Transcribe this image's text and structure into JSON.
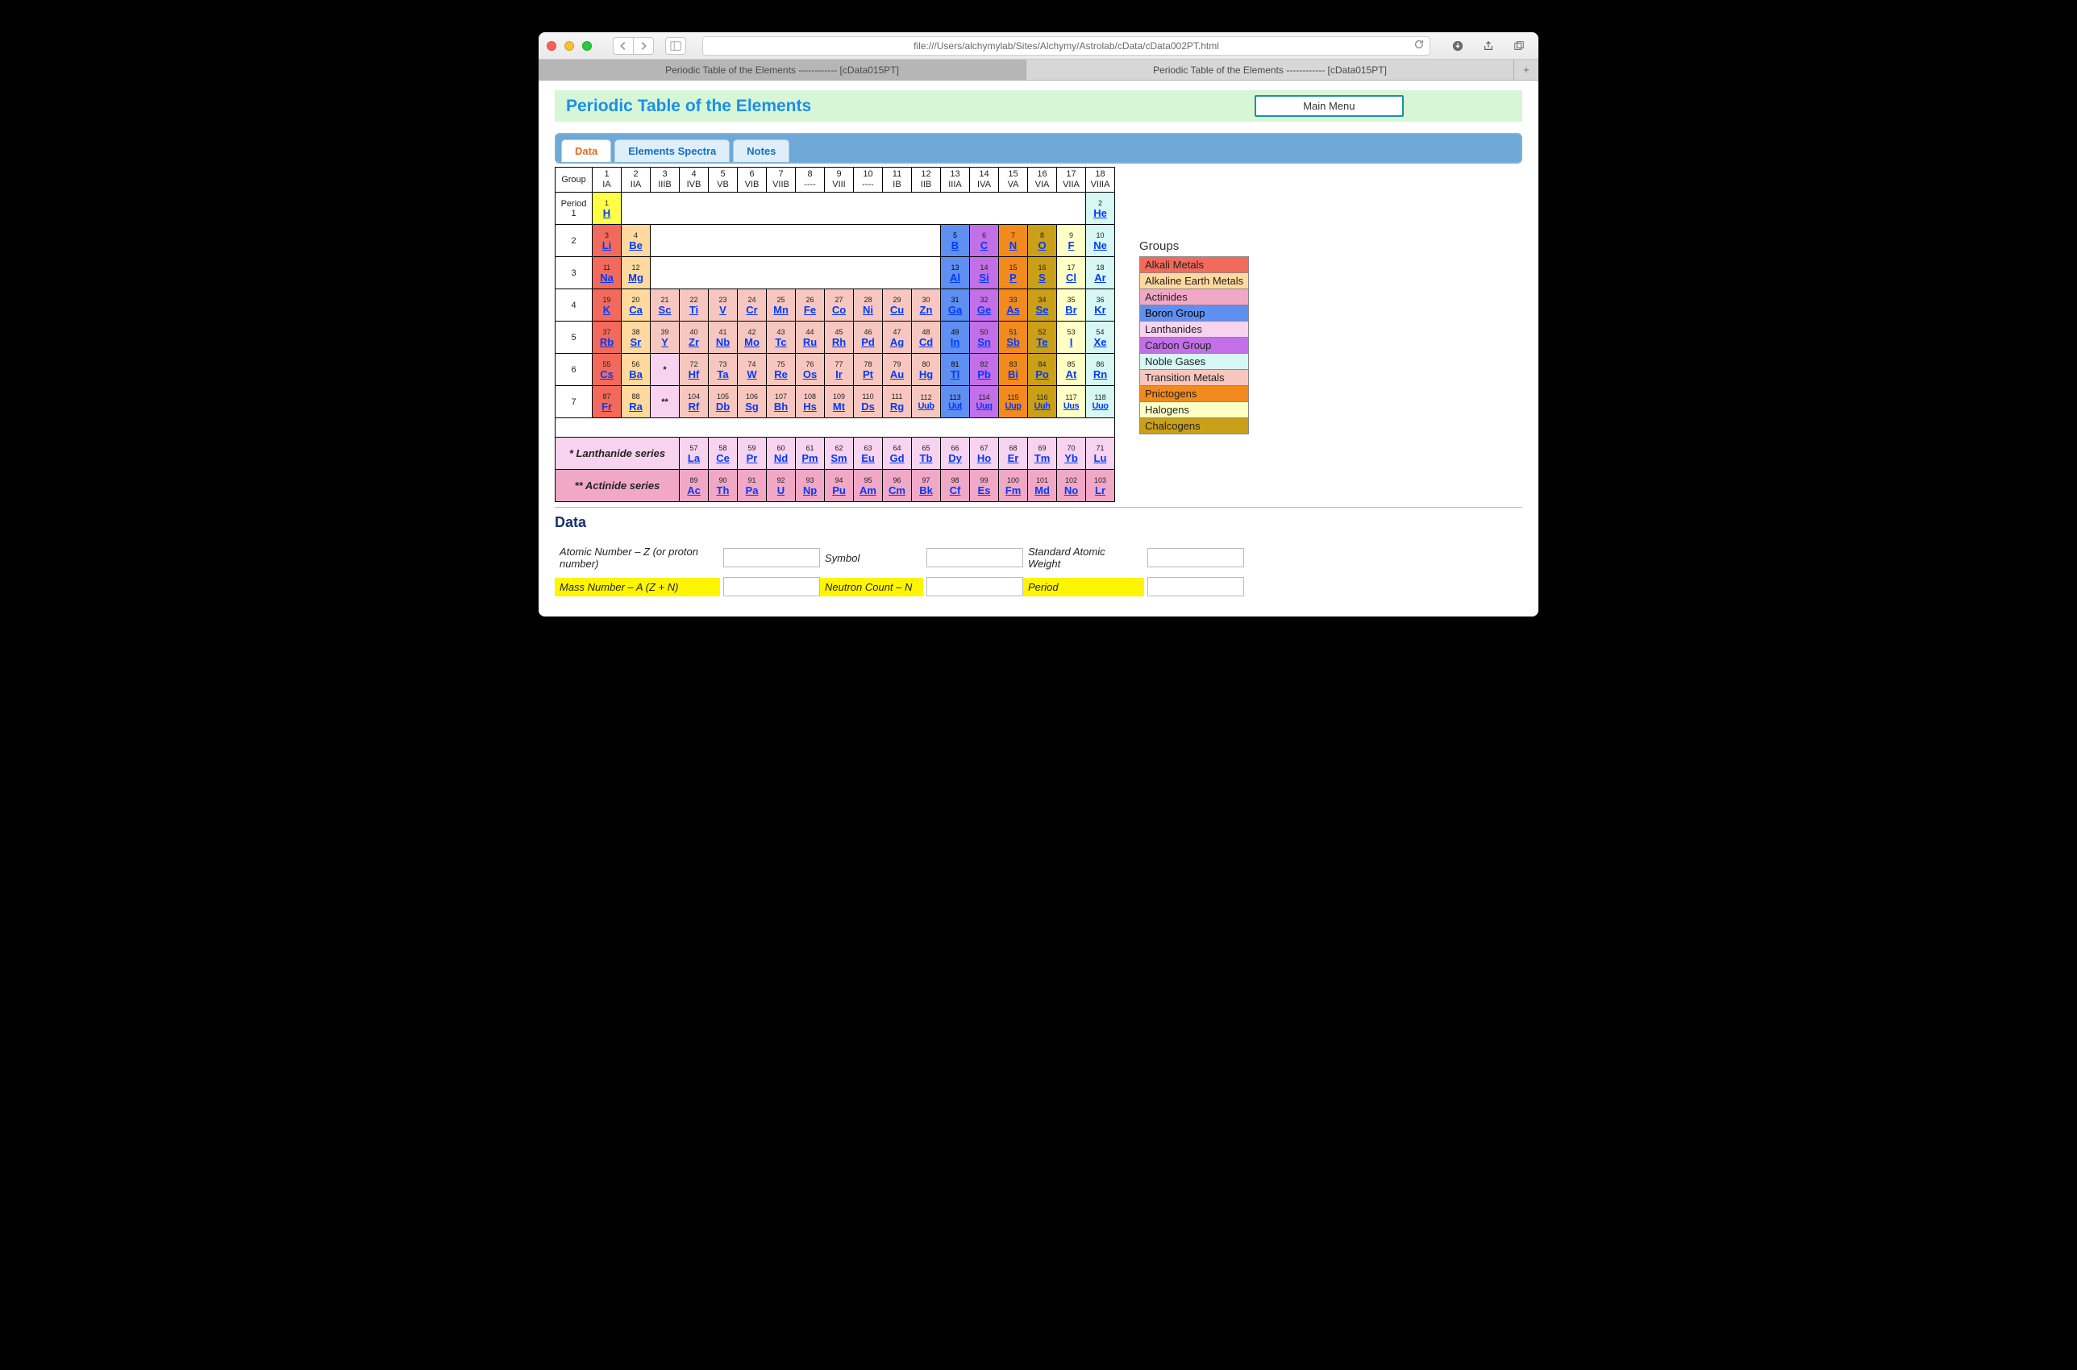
{
  "browser": {
    "url": "file:///Users/alchymylab/Sites/Alchymy/Astrolab/cData/cData002PT.html",
    "tabs": [
      "Periodic Table of the Elements ------------ [cData015PT]",
      "Periodic Table of the Elements ------------ [cData015PT]"
    ],
    "active_tab": 0
  },
  "header": {
    "title": "Periodic Table of the Elements",
    "main_menu": "Main Menu"
  },
  "page_tabs": {
    "items": [
      "Data",
      "Elements Spectra",
      "Notes"
    ],
    "active": 0
  },
  "group_header": {
    "label": "Group",
    "cols": [
      {
        "n": "1",
        "r": "IA"
      },
      {
        "n": "2",
        "r": "IIA"
      },
      {
        "n": "3",
        "r": "IIIB"
      },
      {
        "n": "4",
        "r": "IVB"
      },
      {
        "n": "5",
        "r": "VB"
      },
      {
        "n": "6",
        "r": "VIB"
      },
      {
        "n": "7",
        "r": "VIIB"
      },
      {
        "n": "8",
        "r": "----"
      },
      {
        "n": "9",
        "r": "VIII"
      },
      {
        "n": "10",
        "r": "----"
      },
      {
        "n": "11",
        "r": "IB"
      },
      {
        "n": "12",
        "r": "IIB"
      },
      {
        "n": "13",
        "r": "IIIA"
      },
      {
        "n": "14",
        "r": "IVA"
      },
      {
        "n": "15",
        "r": "VA"
      },
      {
        "n": "16",
        "r": "VIA"
      },
      {
        "n": "17",
        "r": "VIIA"
      },
      {
        "n": "18",
        "r": "VIIIA"
      }
    ]
  },
  "period_labels": [
    "Period 1",
    "2",
    "3",
    "4",
    "5",
    "6",
    "7"
  ],
  "rows": [
    [
      {
        "z": 1,
        "s": "H",
        "c": "c-H"
      },
      null,
      null,
      null,
      null,
      null,
      null,
      null,
      null,
      null,
      null,
      null,
      null,
      null,
      null,
      null,
      null,
      {
        "z": 2,
        "s": "He",
        "c": "c-ng"
      }
    ],
    [
      {
        "z": 3,
        "s": "Li",
        "c": "c-am"
      },
      {
        "z": 4,
        "s": "Be",
        "c": "c-aem"
      },
      null,
      null,
      null,
      null,
      null,
      null,
      null,
      null,
      null,
      null,
      {
        "z": 5,
        "s": "B",
        "c": "c-bg"
      },
      {
        "z": 6,
        "s": "C",
        "c": "c-cg"
      },
      {
        "z": 7,
        "s": "N",
        "c": "c-pn"
      },
      {
        "z": 8,
        "s": "O",
        "c": "c-chg"
      },
      {
        "z": 9,
        "s": "F",
        "c": "c-hal"
      },
      {
        "z": 10,
        "s": "Ne",
        "c": "c-ng"
      }
    ],
    [
      {
        "z": 11,
        "s": "Na",
        "c": "c-am"
      },
      {
        "z": 12,
        "s": "Mg",
        "c": "c-aem"
      },
      null,
      null,
      null,
      null,
      null,
      null,
      null,
      null,
      null,
      null,
      {
        "z": 13,
        "s": "Al",
        "c": "c-bg"
      },
      {
        "z": 14,
        "s": "Si",
        "c": "c-cg"
      },
      {
        "z": 15,
        "s": "P",
        "c": "c-pn"
      },
      {
        "z": 16,
        "s": "S",
        "c": "c-chg"
      },
      {
        "z": 17,
        "s": "Cl",
        "c": "c-hal"
      },
      {
        "z": 18,
        "s": "Ar",
        "c": "c-ng"
      }
    ],
    [
      {
        "z": 19,
        "s": "K",
        "c": "c-am"
      },
      {
        "z": 20,
        "s": "Ca",
        "c": "c-aem"
      },
      {
        "z": 21,
        "s": "Sc",
        "c": "c-tm"
      },
      {
        "z": 22,
        "s": "Ti",
        "c": "c-tm"
      },
      {
        "z": 23,
        "s": "V",
        "c": "c-tm"
      },
      {
        "z": 24,
        "s": "Cr",
        "c": "c-tm"
      },
      {
        "z": 25,
        "s": "Mn",
        "c": "c-tm"
      },
      {
        "z": 26,
        "s": "Fe",
        "c": "c-tm"
      },
      {
        "z": 27,
        "s": "Co",
        "c": "c-tm"
      },
      {
        "z": 28,
        "s": "Ni",
        "c": "c-tm"
      },
      {
        "z": 29,
        "s": "Cu",
        "c": "c-tm"
      },
      {
        "z": 30,
        "s": "Zn",
        "c": "c-tm"
      },
      {
        "z": 31,
        "s": "Ga",
        "c": "c-bg"
      },
      {
        "z": 32,
        "s": "Ge",
        "c": "c-cg"
      },
      {
        "z": 33,
        "s": "As",
        "c": "c-pn"
      },
      {
        "z": 34,
        "s": "Se",
        "c": "c-chg"
      },
      {
        "z": 35,
        "s": "Br",
        "c": "c-hal"
      },
      {
        "z": 36,
        "s": "Kr",
        "c": "c-ng"
      }
    ],
    [
      {
        "z": 37,
        "s": "Rb",
        "c": "c-am"
      },
      {
        "z": 38,
        "s": "Sr",
        "c": "c-aem"
      },
      {
        "z": 39,
        "s": "Y",
        "c": "c-tm"
      },
      {
        "z": 40,
        "s": "Zr",
        "c": "c-tm"
      },
      {
        "z": 41,
        "s": "Nb",
        "c": "c-tm"
      },
      {
        "z": 42,
        "s": "Mo",
        "c": "c-tm"
      },
      {
        "z": 43,
        "s": "Tc",
        "c": "c-tm"
      },
      {
        "z": 44,
        "s": "Ru",
        "c": "c-tm"
      },
      {
        "z": 45,
        "s": "Rh",
        "c": "c-tm"
      },
      {
        "z": 46,
        "s": "Pd",
        "c": "c-tm"
      },
      {
        "z": 47,
        "s": "Ag",
        "c": "c-tm"
      },
      {
        "z": 48,
        "s": "Cd",
        "c": "c-tm"
      },
      {
        "z": 49,
        "s": "In",
        "c": "c-bg"
      },
      {
        "z": 50,
        "s": "Sn",
        "c": "c-cg"
      },
      {
        "z": 51,
        "s": "Sb",
        "c": "c-pn"
      },
      {
        "z": 52,
        "s": "Te",
        "c": "c-chg"
      },
      {
        "z": 53,
        "s": "I",
        "c": "c-hal"
      },
      {
        "z": 54,
        "s": "Xe",
        "c": "c-ng"
      }
    ],
    [
      {
        "z": 55,
        "s": "Cs",
        "c": "c-am"
      },
      {
        "z": 56,
        "s": "Ba",
        "c": "c-aem"
      },
      {
        "mark": "*",
        "c": "c-lan"
      },
      {
        "z": 72,
        "s": "Hf",
        "c": "c-tm"
      },
      {
        "z": 73,
        "s": "Ta",
        "c": "c-tm"
      },
      {
        "z": 74,
        "s": "W",
        "c": "c-tm"
      },
      {
        "z": 75,
        "s": "Re",
        "c": "c-tm"
      },
      {
        "z": 76,
        "s": "Os",
        "c": "c-tm"
      },
      {
        "z": 77,
        "s": "Ir",
        "c": "c-tm"
      },
      {
        "z": 78,
        "s": "Pt",
        "c": "c-tm"
      },
      {
        "z": 79,
        "s": "Au",
        "c": "c-tm"
      },
      {
        "z": 80,
        "s": "Hg",
        "c": "c-tm"
      },
      {
        "z": 81,
        "s": "Tl",
        "c": "c-bg"
      },
      {
        "z": 82,
        "s": "Pb",
        "c": "c-cg"
      },
      {
        "z": 83,
        "s": "Bi",
        "c": "c-pn"
      },
      {
        "z": 84,
        "s": "Po",
        "c": "c-chg"
      },
      {
        "z": 85,
        "s": "At",
        "c": "c-hal"
      },
      {
        "z": 86,
        "s": "Rn",
        "c": "c-ng"
      }
    ],
    [
      {
        "z": 87,
        "s": "Fr",
        "c": "c-am"
      },
      {
        "z": 88,
        "s": "Ra",
        "c": "c-aem"
      },
      {
        "mark": "**",
        "c": "c-act"
      },
      {
        "z": 104,
        "s": "Rf",
        "c": "c-tm"
      },
      {
        "z": 105,
        "s": "Db",
        "c": "c-tm"
      },
      {
        "z": 106,
        "s": "Sg",
        "c": "c-tm"
      },
      {
        "z": 107,
        "s": "Bh",
        "c": "c-tm"
      },
      {
        "z": 108,
        "s": "Hs",
        "c": "c-tm"
      },
      {
        "z": 109,
        "s": "Mt",
        "c": "c-tm"
      },
      {
        "z": 110,
        "s": "Ds",
        "c": "c-tm"
      },
      {
        "z": 111,
        "s": "Rg",
        "c": "c-tm"
      },
      {
        "z": 112,
        "s": "Uub",
        "c": "c-tm"
      },
      {
        "z": 113,
        "s": "Uut",
        "c": "c-bg"
      },
      {
        "z": 114,
        "s": "Uuq",
        "c": "c-cg"
      },
      {
        "z": 115,
        "s": "Uup",
        "c": "c-pn"
      },
      {
        "z": 116,
        "s": "Uuh",
        "c": "c-chg"
      },
      {
        "z": 117,
        "s": "Uus",
        "c": "c-hal"
      },
      {
        "z": 118,
        "s": "Uuo",
        "c": "c-ng"
      }
    ]
  ],
  "series": {
    "lanth": {
      "label": "* Lanthanide series",
      "cells": [
        {
          "z": 57,
          "s": "La"
        },
        {
          "z": 58,
          "s": "Ce"
        },
        {
          "z": 59,
          "s": "Pr"
        },
        {
          "z": 60,
          "s": "Nd"
        },
        {
          "z": 61,
          "s": "Pm"
        },
        {
          "z": 62,
          "s": "Sm"
        },
        {
          "z": 63,
          "s": "Eu"
        },
        {
          "z": 64,
          "s": "Gd"
        },
        {
          "z": 65,
          "s": "Tb"
        },
        {
          "z": 66,
          "s": "Dy"
        },
        {
          "z": 67,
          "s": "Ho"
        },
        {
          "z": 68,
          "s": "Er"
        },
        {
          "z": 69,
          "s": "Tm"
        },
        {
          "z": 70,
          "s": "Yb"
        },
        {
          "z": 71,
          "s": "Lu"
        }
      ]
    },
    "act": {
      "label": "** Actinide series",
      "cells": [
        {
          "z": 89,
          "s": "Ac"
        },
        {
          "z": 90,
          "s": "Th"
        },
        {
          "z": 91,
          "s": "Pa"
        },
        {
          "z": 92,
          "s": "U"
        },
        {
          "z": 93,
          "s": "Np"
        },
        {
          "z": 94,
          "s": "Pu"
        },
        {
          "z": 95,
          "s": "Am"
        },
        {
          "z": 96,
          "s": "Cm"
        },
        {
          "z": 97,
          "s": "Bk"
        },
        {
          "z": 98,
          "s": "Cf"
        },
        {
          "z": 99,
          "s": "Es"
        },
        {
          "z": 100,
          "s": "Fm"
        },
        {
          "z": 101,
          "s": "Md"
        },
        {
          "z": 102,
          "s": "No"
        },
        {
          "z": 103,
          "s": "Lr"
        }
      ]
    }
  },
  "legend": {
    "title": "Groups",
    "items": [
      {
        "label": "Alkali Metals",
        "cls": "c-am"
      },
      {
        "label": "Alkaline Earth Metals",
        "cls": "c-aem"
      },
      {
        "label": "Actinides",
        "cls": "c-act"
      },
      {
        "label": "Boron Group",
        "cls": "c-bg"
      },
      {
        "label": "Lanthanides",
        "cls": "c-lan"
      },
      {
        "label": "Carbon Group",
        "cls": "c-cg"
      },
      {
        "label": "Noble Gases",
        "cls": "c-ng"
      },
      {
        "label": "Transition Metals",
        "cls": "c-tm"
      },
      {
        "label": "Pnictogens",
        "cls": "c-pn"
      },
      {
        "label": "Halogens",
        "cls": "c-hal"
      },
      {
        "label": "Chalcogens",
        "cls": "c-chg"
      }
    ]
  },
  "data_form": {
    "heading": "Data",
    "row1": [
      {
        "label": "Atomic Number – Z (or proton number)",
        "hl": false
      },
      {
        "label": "Symbol",
        "hl": false
      },
      {
        "label": "Standard Atomic Weight",
        "hl": false
      }
    ],
    "row2": [
      {
        "label": "Mass Number – A (Z + N)",
        "hl": true
      },
      {
        "label": "Neutron Count – N",
        "hl": true
      },
      {
        "label": "Period",
        "hl": true
      }
    ]
  }
}
